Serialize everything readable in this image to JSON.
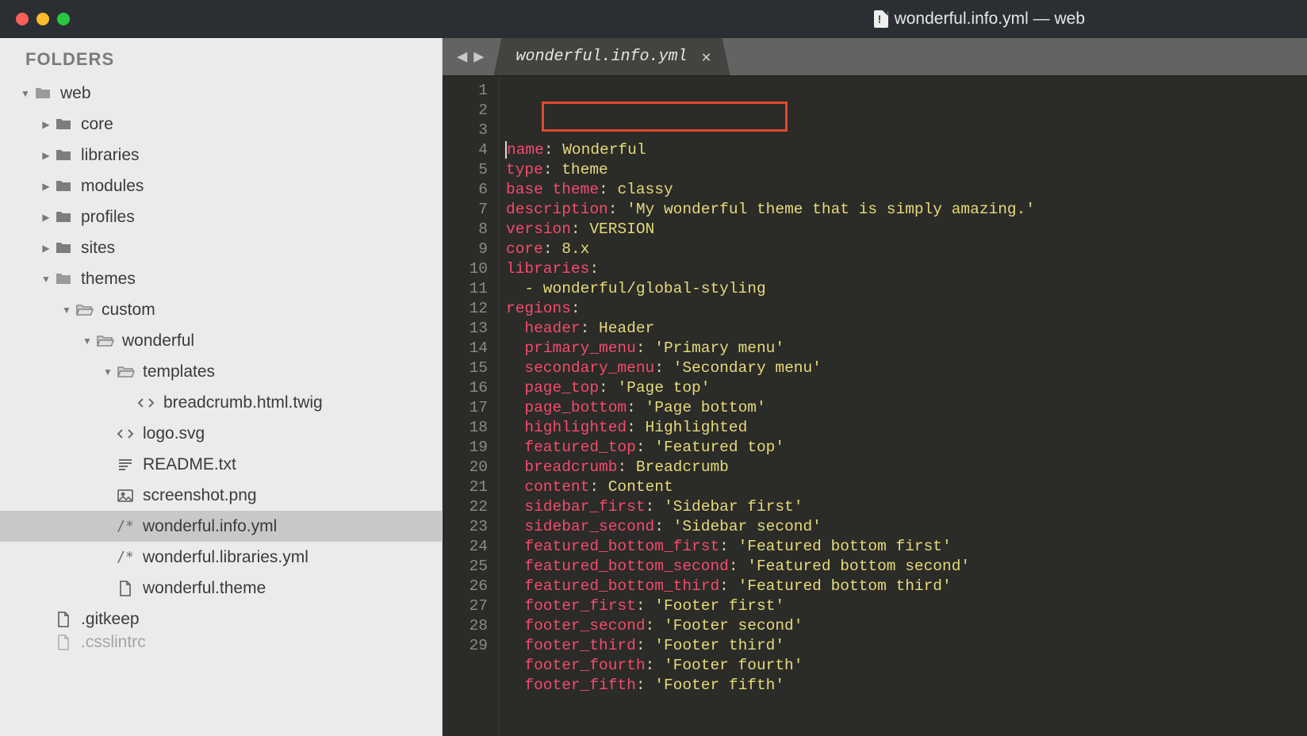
{
  "window": {
    "title": "wonderful.info.yml — web"
  },
  "sidebar": {
    "header": "FOLDERS"
  },
  "tree": [
    {
      "indent": 0,
      "arrow": "down",
      "iconKind": "folder",
      "label": "web"
    },
    {
      "indent": 1,
      "arrow": "right",
      "iconKind": "folderDark",
      "label": "core"
    },
    {
      "indent": 1,
      "arrow": "right",
      "iconKind": "folderDark",
      "label": "libraries"
    },
    {
      "indent": 1,
      "arrow": "right",
      "iconKind": "folderDark",
      "label": "modules"
    },
    {
      "indent": 1,
      "arrow": "right",
      "iconKind": "folderDark",
      "label": "profiles"
    },
    {
      "indent": 1,
      "arrow": "right",
      "iconKind": "folderDark",
      "label": "sites"
    },
    {
      "indent": 1,
      "arrow": "down",
      "iconKind": "folder",
      "label": "themes"
    },
    {
      "indent": 2,
      "arrow": "down",
      "iconKind": "folderOpen",
      "label": "custom"
    },
    {
      "indent": 3,
      "arrow": "down",
      "iconKind": "folderOpen",
      "label": "wonderful"
    },
    {
      "indent": 4,
      "arrow": "down",
      "iconKind": "folderOpen",
      "label": "templates"
    },
    {
      "indent": 5,
      "arrow": "none",
      "iconKind": "code",
      "label": "breadcrumb.html.twig"
    },
    {
      "indent": 4,
      "arrow": "none",
      "iconKind": "code",
      "label": "logo.svg"
    },
    {
      "indent": 4,
      "arrow": "none",
      "iconKind": "text",
      "label": "README.txt"
    },
    {
      "indent": 4,
      "arrow": "none",
      "iconKind": "image",
      "label": "screenshot.png"
    },
    {
      "indent": 4,
      "arrow": "none",
      "iconKind": "yaml",
      "label": "wonderful.info.yml",
      "selected": true
    },
    {
      "indent": 4,
      "arrow": "none",
      "iconKind": "yaml",
      "label": "wonderful.libraries.yml"
    },
    {
      "indent": 4,
      "arrow": "none",
      "iconKind": "file",
      "label": "wonderful.theme"
    },
    {
      "indent": 1,
      "arrow": "none",
      "iconKind": "file",
      "label": ".gitkeep"
    },
    {
      "indent": 1,
      "arrow": "none",
      "iconKind": "file",
      "label": ".csslintrc",
      "partial": true
    }
  ],
  "tab": {
    "title": "wonderful.info.yml"
  },
  "code_lines": [
    {
      "n": 1,
      "tokens": [
        [
          "cursor",
          ""
        ],
        [
          "key",
          "n"
        ],
        [
          "key",
          "ame"
        ],
        [
          "punct",
          ":"
        ],
        [
          "sp",
          " "
        ],
        [
          "str",
          "Wonderful"
        ]
      ]
    },
    {
      "n": 2,
      "tokens": [
        [
          "key",
          "type"
        ],
        [
          "punct",
          ":"
        ],
        [
          "sp",
          " "
        ],
        [
          "str",
          "theme"
        ]
      ]
    },
    {
      "n": 3,
      "tokens": [
        [
          "key",
          "base theme"
        ],
        [
          "punct",
          ":"
        ],
        [
          "sp",
          " "
        ],
        [
          "str",
          "classy"
        ]
      ]
    },
    {
      "n": 4,
      "tokens": [
        [
          "key",
          "description"
        ],
        [
          "punct",
          ":"
        ],
        [
          "sp",
          " "
        ],
        [
          "str",
          "'My wonderful theme that is simply amazing.'"
        ]
      ]
    },
    {
      "n": 5,
      "tokens": [
        [
          "key",
          "version"
        ],
        [
          "punct",
          ":"
        ],
        [
          "sp",
          " "
        ],
        [
          "str",
          "VERSION"
        ]
      ]
    },
    {
      "n": 6,
      "tokens": [
        [
          "key",
          "core"
        ],
        [
          "punct",
          ":"
        ],
        [
          "sp",
          " "
        ],
        [
          "str",
          "8.x"
        ]
      ]
    },
    {
      "n": 7,
      "tokens": [
        [
          "key",
          "libraries"
        ],
        [
          "punct",
          ":"
        ]
      ]
    },
    {
      "n": 8,
      "tokens": [
        [
          "sp",
          "  "
        ],
        [
          "str",
          "- wonderful/global-styling"
        ]
      ]
    },
    {
      "n": 9,
      "tokens": [
        [
          "key",
          "regions"
        ],
        [
          "punct",
          ":"
        ]
      ]
    },
    {
      "n": 10,
      "tokens": [
        [
          "sp",
          "  "
        ],
        [
          "key",
          "header"
        ],
        [
          "punct",
          ":"
        ],
        [
          "sp",
          " "
        ],
        [
          "str",
          "Header"
        ]
      ]
    },
    {
      "n": 11,
      "tokens": [
        [
          "sp",
          "  "
        ],
        [
          "key",
          "primary_menu"
        ],
        [
          "punct",
          ":"
        ],
        [
          "sp",
          " "
        ],
        [
          "str",
          "'Primary menu'"
        ]
      ]
    },
    {
      "n": 12,
      "tokens": [
        [
          "sp",
          "  "
        ],
        [
          "key",
          "secondary_menu"
        ],
        [
          "punct",
          ":"
        ],
        [
          "sp",
          " "
        ],
        [
          "str",
          "'Secondary menu'"
        ]
      ]
    },
    {
      "n": 13,
      "tokens": [
        [
          "sp",
          "  "
        ],
        [
          "key",
          "page_top"
        ],
        [
          "punct",
          ":"
        ],
        [
          "sp",
          " "
        ],
        [
          "str",
          "'Page top'"
        ]
      ]
    },
    {
      "n": 14,
      "tokens": [
        [
          "sp",
          "  "
        ],
        [
          "key",
          "page_bottom"
        ],
        [
          "punct",
          ":"
        ],
        [
          "sp",
          " "
        ],
        [
          "str",
          "'Page bottom'"
        ]
      ]
    },
    {
      "n": 15,
      "tokens": [
        [
          "sp",
          "  "
        ],
        [
          "key",
          "highlighted"
        ],
        [
          "punct",
          ":"
        ],
        [
          "sp",
          " "
        ],
        [
          "str",
          "Highlighted"
        ]
      ]
    },
    {
      "n": 16,
      "tokens": [
        [
          "sp",
          "  "
        ],
        [
          "key",
          "featured_top"
        ],
        [
          "punct",
          ":"
        ],
        [
          "sp",
          " "
        ],
        [
          "str",
          "'Featured top'"
        ]
      ]
    },
    {
      "n": 17,
      "tokens": [
        [
          "sp",
          "  "
        ],
        [
          "key",
          "breadcrumb"
        ],
        [
          "punct",
          ":"
        ],
        [
          "sp",
          " "
        ],
        [
          "str",
          "Breadcrumb"
        ]
      ]
    },
    {
      "n": 18,
      "tokens": [
        [
          "sp",
          "  "
        ],
        [
          "key",
          "content"
        ],
        [
          "punct",
          ":"
        ],
        [
          "sp",
          " "
        ],
        [
          "str",
          "Content"
        ]
      ]
    },
    {
      "n": 19,
      "tokens": [
        [
          "sp",
          "  "
        ],
        [
          "key",
          "sidebar_first"
        ],
        [
          "punct",
          ":"
        ],
        [
          "sp",
          " "
        ],
        [
          "str",
          "'Sidebar first'"
        ]
      ]
    },
    {
      "n": 20,
      "tokens": [
        [
          "sp",
          "  "
        ],
        [
          "key",
          "sidebar_second"
        ],
        [
          "punct",
          ":"
        ],
        [
          "sp",
          " "
        ],
        [
          "str",
          "'Sidebar second'"
        ]
      ]
    },
    {
      "n": 21,
      "tokens": [
        [
          "sp",
          "  "
        ],
        [
          "key",
          "featured_bottom_first"
        ],
        [
          "punct",
          ":"
        ],
        [
          "sp",
          " "
        ],
        [
          "str",
          "'Featured bottom first'"
        ]
      ]
    },
    {
      "n": 22,
      "tokens": [
        [
          "sp",
          "  "
        ],
        [
          "key",
          "featured_bottom_second"
        ],
        [
          "punct",
          ":"
        ],
        [
          "sp",
          " "
        ],
        [
          "str",
          "'Featured bottom second'"
        ]
      ]
    },
    {
      "n": 23,
      "tokens": [
        [
          "sp",
          "  "
        ],
        [
          "key",
          "featured_bottom_third"
        ],
        [
          "punct",
          ":"
        ],
        [
          "sp",
          " "
        ],
        [
          "str",
          "'Featured bottom third'"
        ]
      ]
    },
    {
      "n": 24,
      "tokens": [
        [
          "sp",
          "  "
        ],
        [
          "key",
          "footer_first"
        ],
        [
          "punct",
          ":"
        ],
        [
          "sp",
          " "
        ],
        [
          "str",
          "'Footer first'"
        ]
      ]
    },
    {
      "n": 25,
      "tokens": [
        [
          "sp",
          "  "
        ],
        [
          "key",
          "footer_second"
        ],
        [
          "punct",
          ":"
        ],
        [
          "sp",
          " "
        ],
        [
          "str",
          "'Footer second'"
        ]
      ]
    },
    {
      "n": 26,
      "tokens": [
        [
          "sp",
          "  "
        ],
        [
          "key",
          "footer_third"
        ],
        [
          "punct",
          ":"
        ],
        [
          "sp",
          " "
        ],
        [
          "str",
          "'Footer third'"
        ]
      ]
    },
    {
      "n": 27,
      "tokens": [
        [
          "sp",
          "  "
        ],
        [
          "key",
          "footer_fourth"
        ],
        [
          "punct",
          ":"
        ],
        [
          "sp",
          " "
        ],
        [
          "str",
          "'Footer fourth'"
        ]
      ]
    },
    {
      "n": 28,
      "tokens": [
        [
          "sp",
          "  "
        ],
        [
          "key",
          "footer_fifth"
        ],
        [
          "punct",
          ":"
        ],
        [
          "sp",
          " "
        ],
        [
          "str",
          "'Footer fifth'"
        ]
      ]
    },
    {
      "n": 29,
      "tokens": []
    }
  ],
  "icons": {
    "svg": {
      "folder": "<svg viewBox='0 0 24 24' fill='#9a9a9a'><path d='M3 5h6l2 2h10v11H3z'/></svg>",
      "folderDark": "<svg viewBox='0 0 24 24' fill='#7d7d7d'><path d='M3 5h6l2 2h10v11H3z'/></svg>",
      "folderOpen": "<svg viewBox='0 0 24 24' fill='none' stroke='#8a8a8a' stroke-width='1.6'><path d='M3 6h6l2 2h10v3H5.5L3 18z' fill='#cfcfcf'/><path d='M3 18l2.5-7H23l-2.5 7z' fill='#e0e0e0'/></svg>",
      "code": "<svg viewBox='0 0 24 24' fill='none' stroke='#6b6b6b' stroke-width='2'><path d='M8 7l-5 5 5 5'/><path d='M16 7l5 5-5 5'/></svg>",
      "text": "<svg viewBox='0 0 24 24' fill='none' stroke='#6b6b6b' stroke-width='2'><path d='M4 6h16M4 10h16M4 14h11'/><path d='M4 18h8'/><path d='M4 6v0' /></svg>",
      "image": "<svg viewBox='0 0 24 24' fill='none' stroke='#6b6b6b' stroke-width='1.8'><rect x='3' y='5' width='18' height='14' rx='1'/><circle cx='9' cy='10' r='1.6' fill='#6b6b6b'/><path d='M4 18l5-5 4 4 3-3 4 4'/></svg>",
      "yaml": "<svg viewBox='0 0 24 24' fill='none' stroke='#6b6b6b' stroke-width='2'><path d='M4 6l8 12'/><path d='M12 6l8 0'/><path d='M12 6l0 0'/><text x='4' y='18' font-size='9' fill='#6b6b6b' font-family='monospace'></text><path d='M5 6 l4 7'/><path d='M13 6 l-4 7'/><path d='M16 10 l4 8'/><path d='M14 18 h5'/><path d='M14 14 l3 -4'/><path d='M5 6 l0 0'/></svg>",
      "file": "<svg viewBox='0 0 24 24' fill='none' stroke='#6b6b6b' stroke-width='1.8'><path d='M6 3h8l4 4v14H6z'/><path d='M14 3v4h4'/></svg>"
    }
  }
}
